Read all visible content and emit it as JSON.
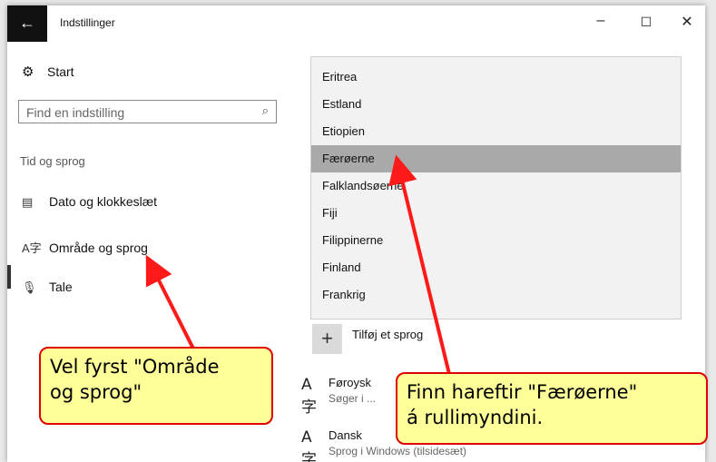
{
  "window": {
    "back_label": "←",
    "title": "Indstillinger",
    "minimize_label": "–",
    "maximize_label": "☐",
    "close_label": "✕"
  },
  "sidebar": {
    "home_label": "Start",
    "search_placeholder": "Find en indstilling",
    "section_title": "Tid og sprog",
    "items": [
      {
        "label": "Dato og klokkeslæt",
        "icon": "calendar-clock-icon"
      },
      {
        "label": "Område og sprog",
        "icon": "language-icon"
      },
      {
        "label": "Tale",
        "icon": "microphone-icon"
      }
    ]
  },
  "dropdown": {
    "items": [
      "Eritrea",
      "Estland",
      "Etiopien",
      "Færøerne",
      "Falklandsøerne",
      "Fiji",
      "Filippinerne",
      "Finland",
      "Frankrig"
    ],
    "selected": "Færøerne"
  },
  "languages": {
    "add_label": "Tilføj et sprog",
    "entries": [
      {
        "name": "Føroysk",
        "sub": "Søger i ..."
      },
      {
        "name": "Dansk",
        "sub": "Sprog i Windows (tilsidesæt)"
      }
    ]
  },
  "callouts": {
    "first_line1": "Vel fyrst \"Område",
    "first_line2": "og sprog\"",
    "second_line1": "Finn hareftir \"Færøerne\"",
    "second_line2": "á rullimyndini."
  },
  "colors": {
    "accent_black": "#111111",
    "selection": "#a9a9a9",
    "callout_fill": "#ffff99",
    "callout_border": "#e00000"
  }
}
